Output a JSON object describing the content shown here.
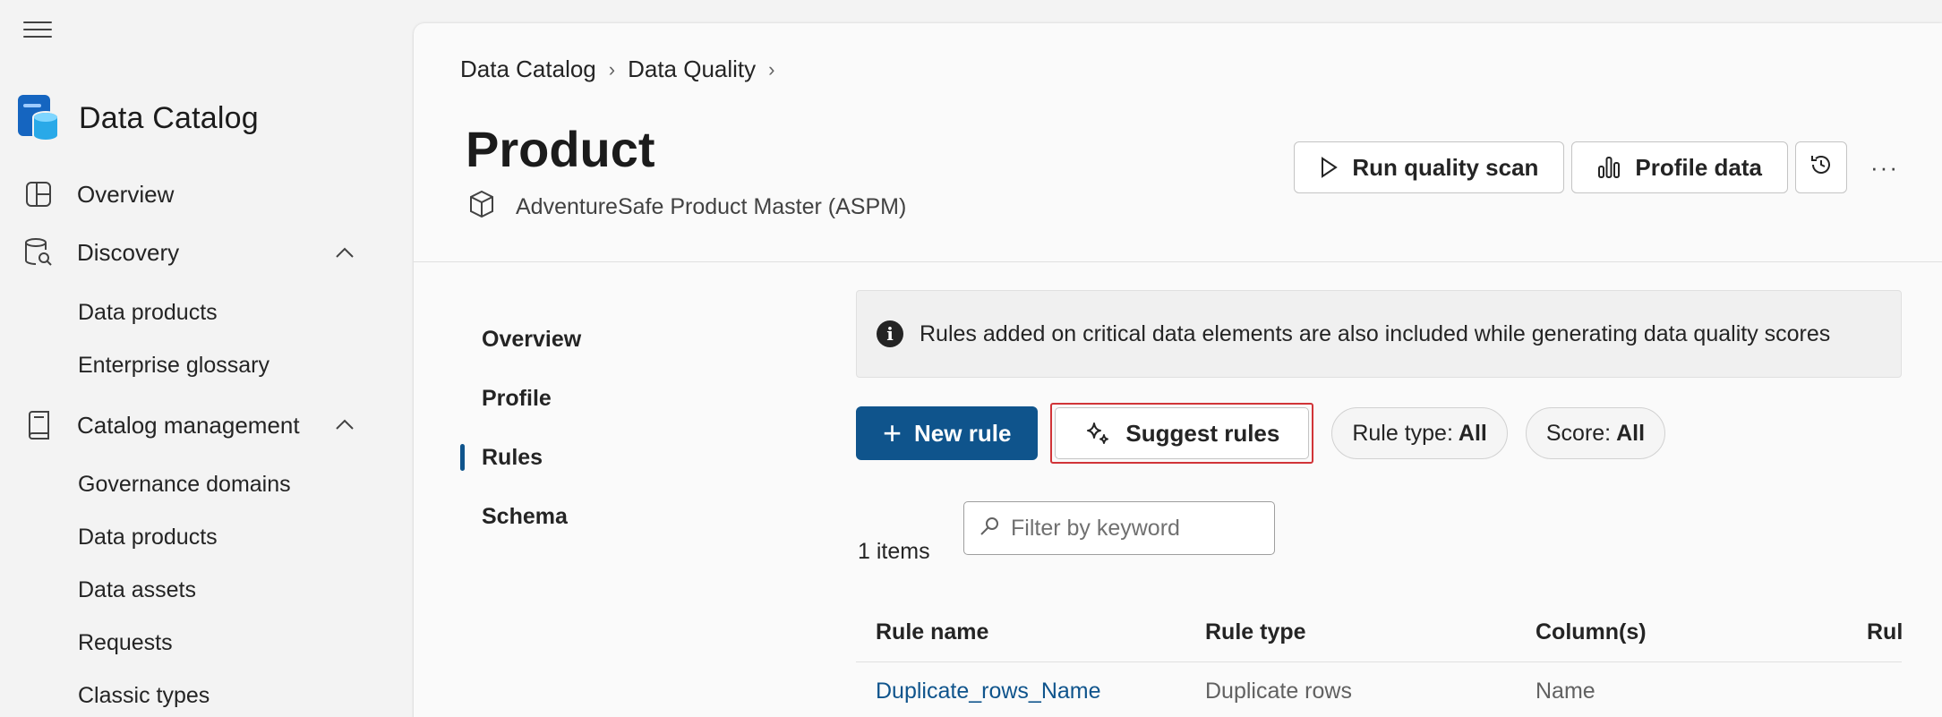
{
  "sidebar": {
    "app_title": "Data Catalog",
    "items": [
      {
        "label": "Overview",
        "icon": "layout-grid-icon"
      },
      {
        "label": "Discovery",
        "icon": "database-search-icon",
        "expanded": true,
        "children": [
          "Data products",
          "Enterprise glossary"
        ]
      },
      {
        "label": "Catalog management",
        "icon": "book-icon",
        "expanded": true,
        "children": [
          "Governance domains",
          "Data products",
          "Data assets",
          "Requests",
          "Classic types"
        ]
      }
    ]
  },
  "breadcrumb": [
    "Data Catalog",
    "Data Quality"
  ],
  "header": {
    "title": "Product",
    "subtitle": "AdventureSafe Product Master (ASPM)",
    "run_scan_label": "Run quality scan",
    "profile_label": "Profile data",
    "more_label": "···"
  },
  "tabs": [
    "Overview",
    "Profile",
    "Rules",
    "Schema"
  ],
  "active_tab": "Rules",
  "info_message": "Rules added on critical data elements are also included while generating data quality scores",
  "toolbar": {
    "new_rule_label": "New rule",
    "suggest_rules_label": "Suggest rules",
    "rule_type_filter": {
      "label": "Rule type:",
      "value": "All"
    },
    "score_filter": {
      "label": "Score:",
      "value": "All"
    }
  },
  "items_count": "1 items",
  "search": {
    "placeholder": "Filter by keyword",
    "value": ""
  },
  "table": {
    "columns": [
      "Rule name",
      "Rule type",
      "Column(s)",
      "Rul"
    ],
    "rows": [
      {
        "rule_name": "Duplicate_rows_Name",
        "rule_type": "Duplicate rows",
        "columns": "Name"
      }
    ]
  },
  "colors": {
    "primary": "#0f548c",
    "highlight_border": "#d13438",
    "link": "#0f548c"
  }
}
